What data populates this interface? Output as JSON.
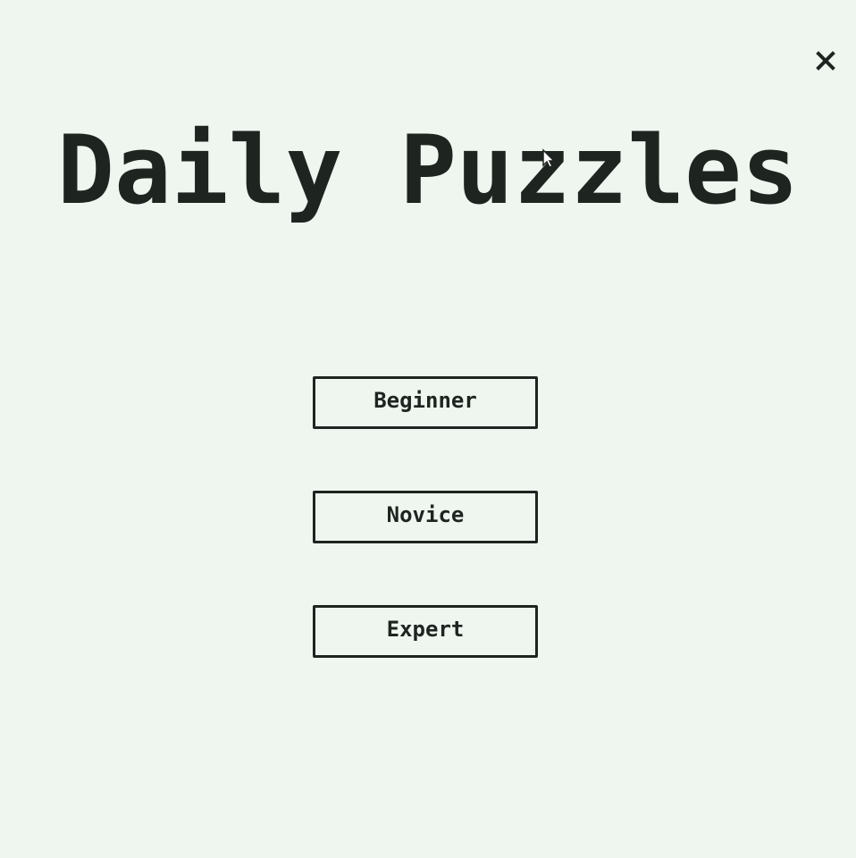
{
  "window": {
    "close_icon": "close-icon"
  },
  "title": "Daily Puzzles",
  "difficulty_buttons": [
    {
      "label": "Beginner"
    },
    {
      "label": "Novice"
    },
    {
      "label": "Expert"
    }
  ],
  "colors": {
    "background": "#eff6f0",
    "foreground": "#1e2420"
  }
}
